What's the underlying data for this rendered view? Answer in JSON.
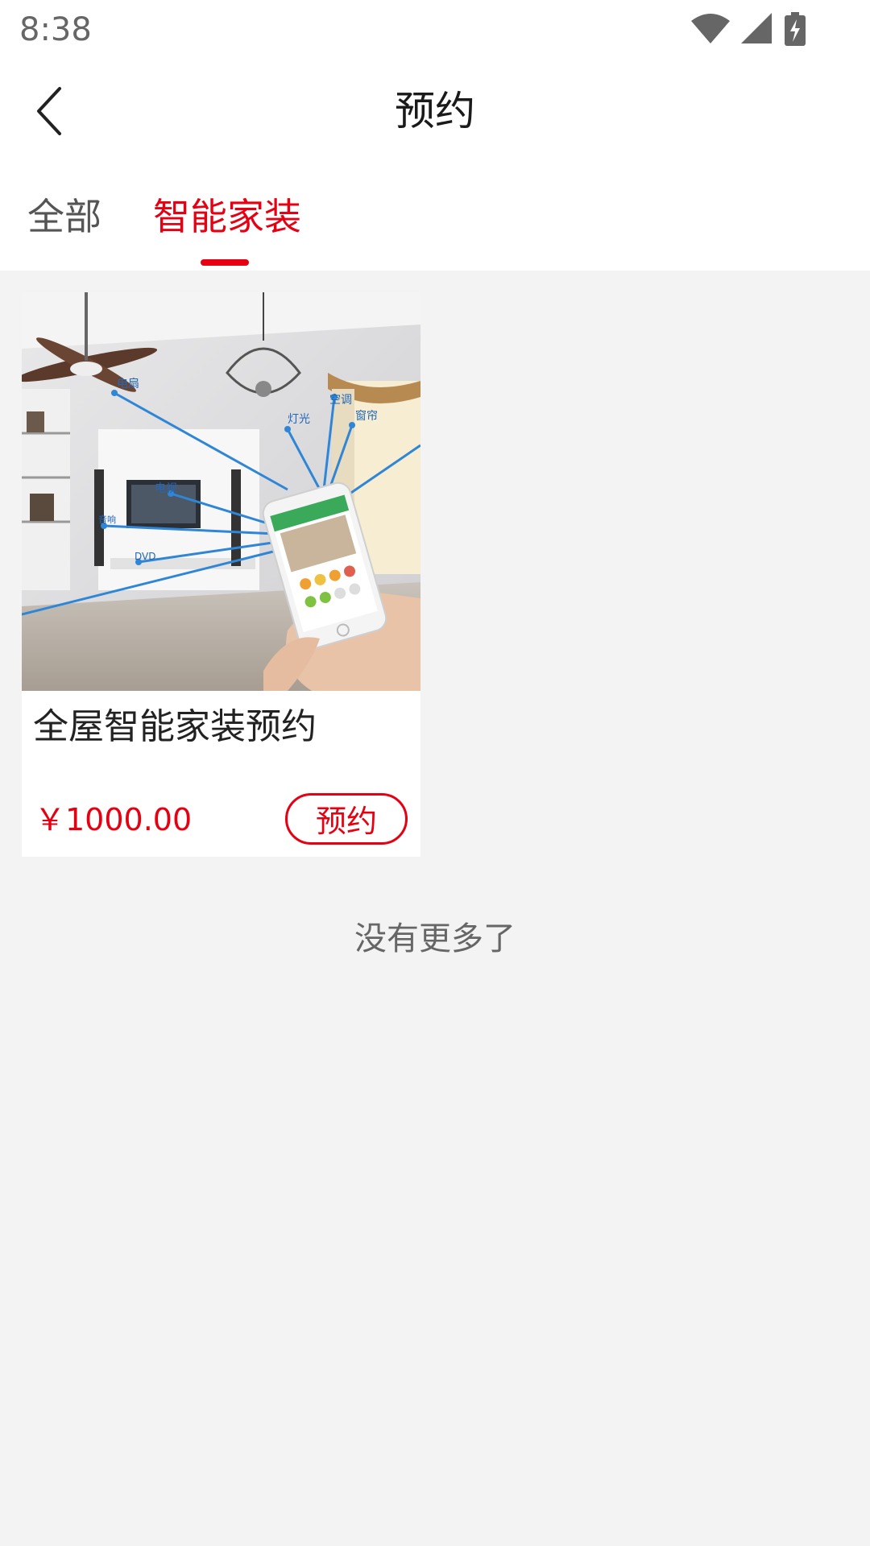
{
  "status_bar": {
    "time": "8:38",
    "icons": [
      "wifi-icon",
      "cell-signal-icon",
      "battery-charging-icon"
    ]
  },
  "header": {
    "back_icon": "chevron-left-icon",
    "title": "预约"
  },
  "tabs": [
    {
      "label": "全部",
      "active": false
    },
    {
      "label": "智能家装",
      "active": true
    }
  ],
  "products": [
    {
      "image_labels": {
        "fan": "电扇",
        "light": "灯光",
        "ac": "空调",
        "curtain": "窗帘",
        "tv": "电视",
        "speaker": "音响",
        "dvd": "DVD"
      },
      "title": "全屋智能家装预约",
      "price": "￥1000.00",
      "button_label": "预约"
    }
  ],
  "footer": {
    "no_more_text": "没有更多了"
  },
  "colors": {
    "accent": "#e60012",
    "background": "#f3f3f3"
  }
}
